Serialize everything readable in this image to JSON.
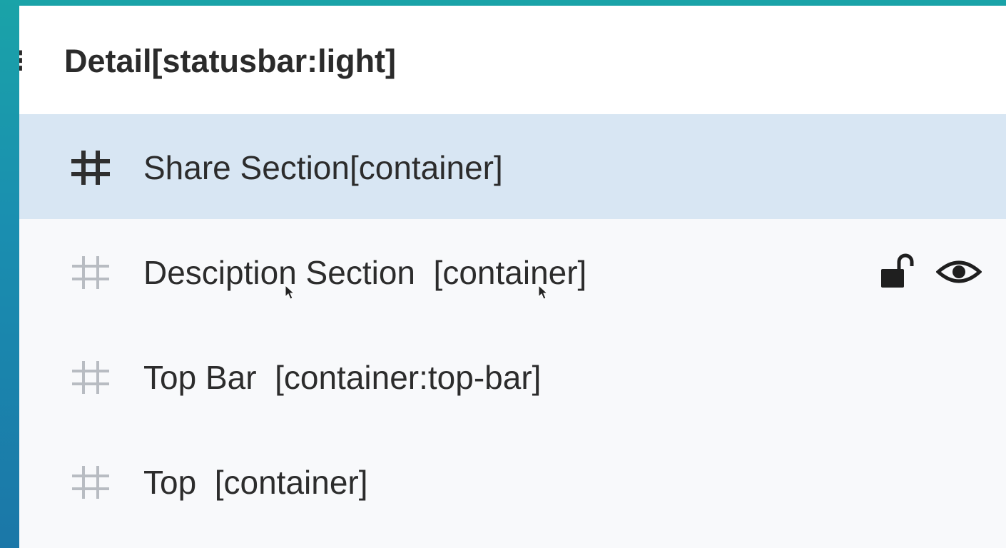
{
  "header": {
    "icon": "component-icon",
    "title": "Detail[statusbar:light]"
  },
  "layers": [
    {
      "label": "Share Section[container]",
      "icon": "hash-icon",
      "selected": true
    },
    {
      "label": "Desciption Section  [container]",
      "icon": "hash-icon",
      "selected": false,
      "hovered": true,
      "actions": [
        "unlock-icon",
        "eye-icon"
      ]
    },
    {
      "label": "Top Bar  [container:top-bar]",
      "icon": "hash-icon",
      "selected": false
    },
    {
      "label": "Top  [container]",
      "icon": "hash-icon",
      "selected": false
    }
  ],
  "colors": {
    "selected_row": "#d8e6f3",
    "panel_bg": "#f8f9fb",
    "header_bg": "#ffffff",
    "active_icon": "#2f2f2f",
    "muted_icon": "#b8bcc2",
    "text": "#2c2c2c"
  }
}
